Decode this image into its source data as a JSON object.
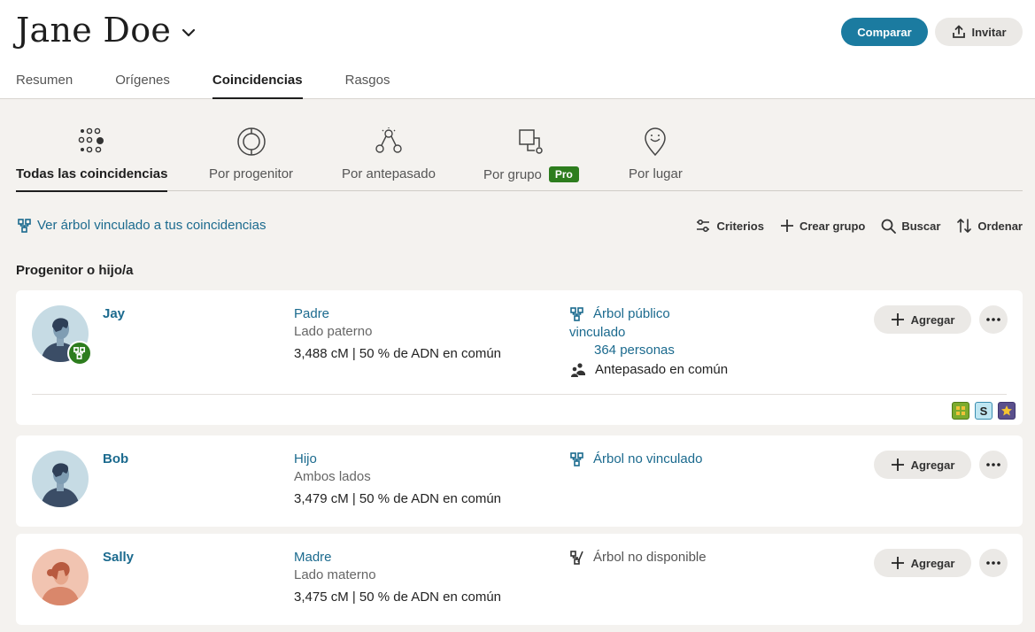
{
  "header": {
    "title": "Jane Doe",
    "compare_label": "Comparar",
    "invite_label": "Invitar"
  },
  "main_tabs": [
    {
      "label": "Resumen",
      "active": false
    },
    {
      "label": "Orígenes",
      "active": false
    },
    {
      "label": "Coincidencias",
      "active": true
    },
    {
      "label": "Rasgos",
      "active": false
    }
  ],
  "filter_tabs": [
    {
      "label": "Todas las coincidencias",
      "icon": "all-matches-icon",
      "active": true
    },
    {
      "label": "Por progenitor",
      "icon": "parent-icon",
      "active": false
    },
    {
      "label": "Por antepasado",
      "icon": "ancestor-icon",
      "active": false
    },
    {
      "label": "Por grupo",
      "icon": "group-icon",
      "badge": "Pro",
      "active": false
    },
    {
      "label": "Por lugar",
      "icon": "place-icon",
      "active": false
    }
  ],
  "tree_link": "Ver árbol vinculado a tus coincidencias",
  "toolbar": {
    "criteria": "Criterios",
    "create_group": "Crear grupo",
    "search": "Buscar",
    "sort": "Ordenar"
  },
  "section_title": "Progenitor o hijo/a",
  "matches": [
    {
      "name": "Jay",
      "relationship": "Padre",
      "side": "Lado paterno",
      "shared_dna": "3,488 cM | 50 % de ADN en común",
      "tree_line1": "Árbol público",
      "tree_line2": "vinculado",
      "tree_count": "364 personas",
      "common_ancestor": "Antepasado en común",
      "add_label": "Agregar",
      "avatar": "male"
    },
    {
      "name": "Bob",
      "relationship": "Hijo",
      "side": "Ambos lados",
      "shared_dna": "3,479 cM | 50 % de ADN en común",
      "tree_line1": "Árbol no vinculado",
      "add_label": "Agregar",
      "avatar": "male"
    },
    {
      "name": "Sally",
      "relationship": "Madre",
      "side": "Lado materno",
      "shared_dna": "3,475 cM | 50 % de ADN en común",
      "tree_line1": "Árbol no disponible",
      "add_label": "Agregar",
      "avatar": "female"
    }
  ],
  "card_tag_letter": "S",
  "colors": {
    "accent": "#1b7ba0",
    "link": "#1b6a8e",
    "pro": "#2d7d1e",
    "background": "#f4f2ef"
  }
}
